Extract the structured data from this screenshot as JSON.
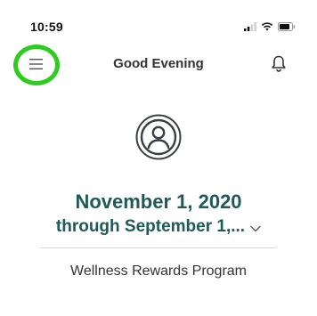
{
  "status_bar": {
    "time": "10:59"
  },
  "header": {
    "title": "Good Evening",
    "menu_icon": "hamburger-menu-icon",
    "bell_icon": "bell-icon",
    "highlight_color": "#2ecc1f"
  },
  "profile": {
    "avatar_icon": "user-avatar-icon"
  },
  "period": {
    "line1": "November 1, 2020",
    "line2": "through September 1,...",
    "color": "#1e5a57"
  },
  "program": {
    "name": "Wellness Rewards Program"
  }
}
